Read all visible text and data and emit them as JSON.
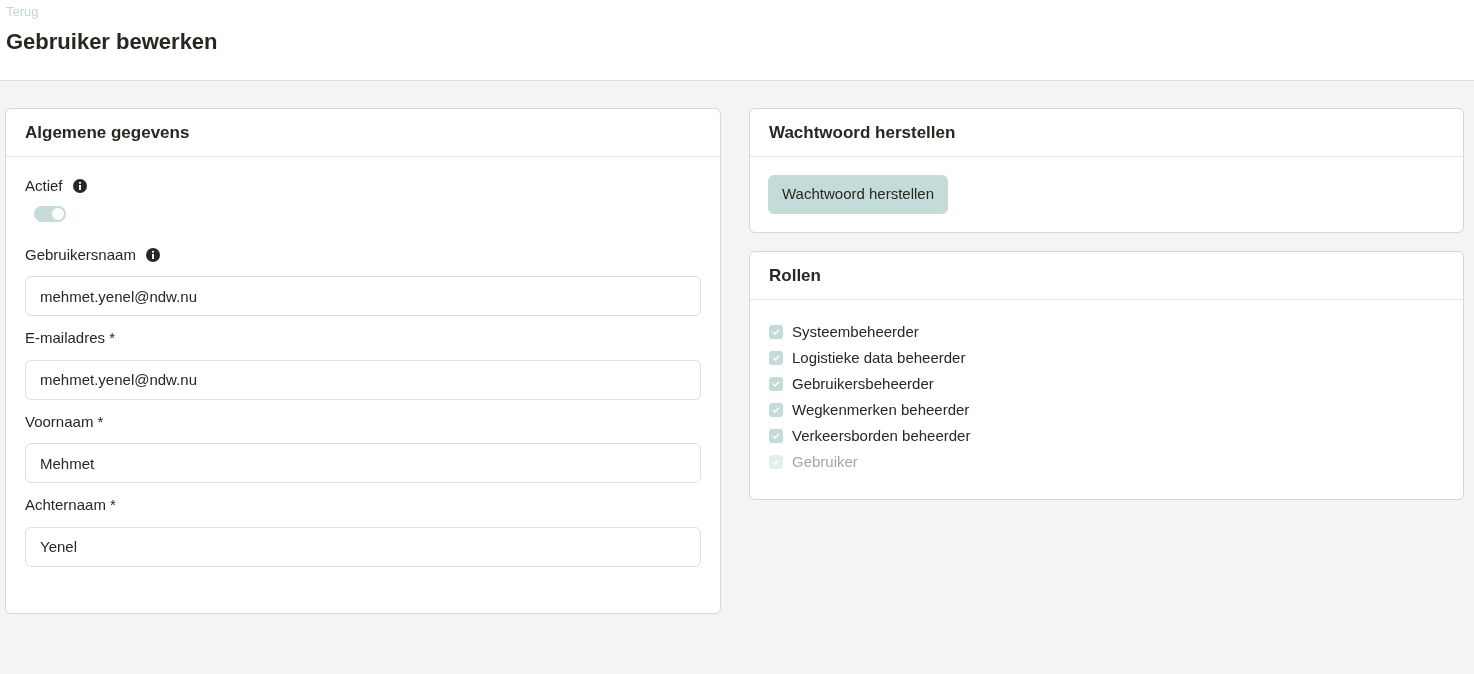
{
  "header": {
    "back_link": "Terug",
    "title": "Gebruiker bewerken"
  },
  "general": {
    "title": "Algemene gegevens",
    "active": {
      "label": "Actief",
      "info": true,
      "on": true,
      "disabled": true
    },
    "fields": [
      {
        "label": "Gebruikersnaam",
        "info": true,
        "value": "mehmet.yenel@ndw.nu"
      },
      {
        "label": "E-mailadres *",
        "info": false,
        "value": "mehmet.yenel@ndw.nu"
      },
      {
        "label": "Voornaam *",
        "info": false,
        "value": "Mehmet"
      },
      {
        "label": "Achternaam *",
        "info": false,
        "value": "Yenel"
      }
    ]
  },
  "password": {
    "title": "Wachtwoord herstellen",
    "button": "Wachtwoord herstellen"
  },
  "roles": {
    "title": "Rollen",
    "items": [
      {
        "label": "Systeembeheerder",
        "checked": true,
        "disabled": false
      },
      {
        "label": "Logistieke data beheerder",
        "checked": true,
        "disabled": false
      },
      {
        "label": "Gebruikersbeheerder",
        "checked": true,
        "disabled": false
      },
      {
        "label": "Wegkenmerken beheerder",
        "checked": true,
        "disabled": false
      },
      {
        "label": "Verkeersborden beheerder",
        "checked": true,
        "disabled": false
      },
      {
        "label": "Gebruiker",
        "checked": true,
        "disabled": true
      }
    ]
  }
}
